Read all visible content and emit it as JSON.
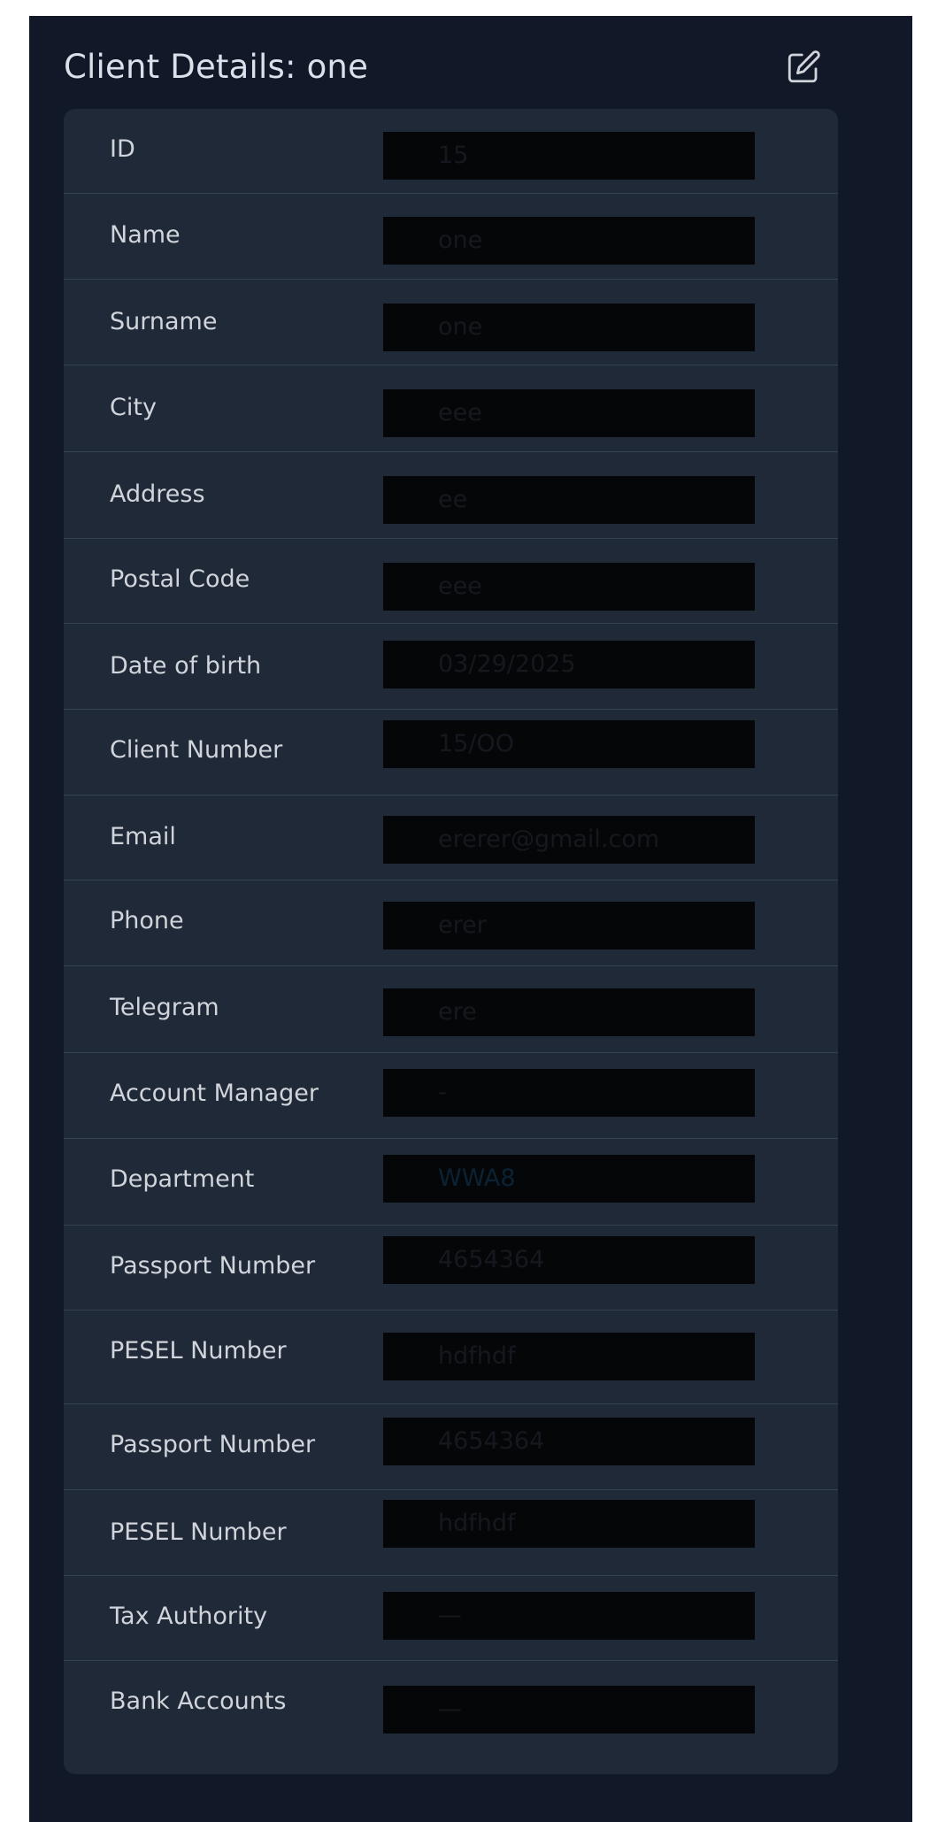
{
  "header": {
    "title": "Client Details: one",
    "edit_icon": "edit-icon"
  },
  "colors": {
    "panel_bg": "#111827",
    "card_bg": "#1f2937",
    "label_text": "#d1d5db",
    "value_box": "#050607"
  },
  "fields": [
    {
      "label": "ID",
      "value": "15"
    },
    {
      "label": "Name",
      "value": "one"
    },
    {
      "label": "Surname",
      "value": "one"
    },
    {
      "label": "City",
      "value": "eee"
    },
    {
      "label": "Address",
      "value": "ee"
    },
    {
      "label": "Postal Code",
      "value": "eee"
    },
    {
      "label": "Date of birth",
      "value": "03/29/2025"
    },
    {
      "label": "Client Number",
      "value": "15/OO"
    },
    {
      "label": "Email",
      "value": "ererer@gmail.com"
    },
    {
      "label": "Phone",
      "value": "erer"
    },
    {
      "label": "Telegram",
      "value": "ere"
    },
    {
      "label": "Account Manager",
      "value": "-"
    },
    {
      "label": "Department",
      "value": "WWA8"
    },
    {
      "label": "Passport Number",
      "value": "4654364"
    },
    {
      "label": "PESEL Number",
      "value": "hdfhdf"
    },
    {
      "label": "Passport Number",
      "value": "4654364"
    },
    {
      "label": "PESEL Number",
      "value": "hdfhdf"
    },
    {
      "label": "Tax Authority",
      "value": "—"
    },
    {
      "label": "Bank Accounts",
      "value": "—"
    }
  ]
}
